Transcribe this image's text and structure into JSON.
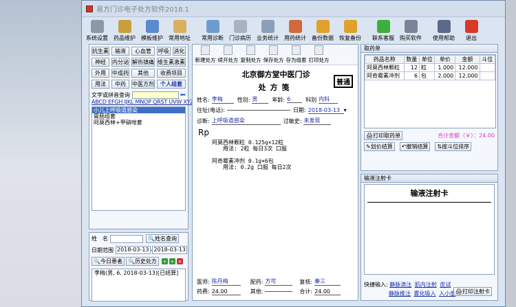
{
  "window_title": "易方门诊电子处方软件2018.1",
  "toolbar": [
    {
      "label": "系统设置",
      "icon": "gear-icon",
      "color": "#8a98a8"
    },
    {
      "label": "药品维护",
      "icon": "medicine-icon",
      "color": "#c8a03a"
    },
    {
      "label": "模板维护",
      "icon": "template-icon",
      "color": "#5a8ad0"
    },
    {
      "label": "常用地址",
      "icon": "map-pin-icon",
      "color": "#d8b060"
    },
    {
      "label": "常用诊断",
      "icon": "diagnosis-icon",
      "color": "#6f9ccf"
    },
    {
      "label": "门诊病历",
      "icon": "record-icon",
      "color": "#a7b3c2"
    },
    {
      "label": "业务统计",
      "icon": "stats-icon",
      "color": "#8aa0b8"
    },
    {
      "label": "用药统计",
      "icon": "pie-chart-icon",
      "color": "#d06a3a"
    },
    {
      "label": "备份数据",
      "icon": "backup-icon",
      "color": "#e0a02a"
    },
    {
      "label": "恢复备份",
      "icon": "restore-icon",
      "color": "#e0a02a"
    },
    {
      "label": "联系客服",
      "icon": "wechat-icon",
      "color": "#3cb03c"
    },
    {
      "label": "购买软件",
      "icon": "buy-icon",
      "color": "#7a8496"
    },
    {
      "label": "使用帮助",
      "icon": "help-icon",
      "color": "#5a6a88"
    },
    {
      "label": "退出",
      "icon": "exit-icon",
      "color": "#d83a2a"
    }
  ],
  "categories": [
    [
      {
        "label": "抗生素"
      },
      {
        "label": "输液"
      },
      {
        "label": "心血管"
      },
      {
        "label": "呼吸"
      },
      {
        "label": "消化"
      }
    ],
    [
      {
        "label": "神经"
      },
      {
        "label": "内分泌"
      },
      {
        "label": "解热镇痛"
      },
      {
        "label": "维生素激素"
      }
    ],
    [
      {
        "label": "外用"
      },
      {
        "label": "中成药"
      },
      {
        "label": "其他"
      },
      {
        "label": "收费项目"
      }
    ],
    [
      {
        "label": "用法"
      },
      {
        "label": "中药"
      },
      {
        "label": "中医方剂"
      },
      {
        "label": "个人组套"
      }
    ]
  ],
  "search_label": "文字或拼音查询",
  "alphabet": "ABCD EFGH IJKL MNOP QRST UVW XYZ",
  "template_list": [
    "小儿上呼吸道感染",
    "胃肠组套",
    "阿莫西林+甲硝唑套"
  ],
  "patient_search": {
    "name_label": "姓　名",
    "name_button": "姓名查询",
    "date_label": "日期范围",
    "date_from": "2018-03-13",
    "date_sep": "-",
    "date_to": "2018-03-13",
    "today_button": "今日患者",
    "history_button": "历史处方",
    "result": "李梅(男, 6, 2018-03-13)[已结算]"
  },
  "center_toolbar": [
    "新建处方",
    "续开处方",
    "复制处方",
    "保存处方",
    "存为组套",
    "打印处方"
  ],
  "prescription": {
    "clinic": "北京御方堂中医门诊",
    "title": "处方笺",
    "type_badge": "普通",
    "name_label": "姓名:",
    "name": "李梅",
    "sex_label": "性别:",
    "sex": "男",
    "age_label": "年龄:",
    "age": "6",
    "dept_label": "科别",
    "dept": "内科",
    "address_label": "住址(电话):",
    "address": "",
    "date_label": "日期:",
    "date": "2018-03-13",
    "diagnosis_label": "诊断:",
    "diagnosis": "上呼吸道感染",
    "allergy_label": "过敏史:",
    "allergy": "未发现",
    "rp": "Rp",
    "drugs": [
      {
        "name": "阿莫西林颗粒 0.125g×12粒",
        "usage": "用法: 2粒 每日3次 口服"
      },
      {
        "name": "阿奇霉素冲剂 0.1g×6包",
        "usage": "用法: 0.2g 口服 每日2次"
      }
    ],
    "doctor_label": "医师:",
    "doctor": "陈丹梅",
    "dispense_label": "配药:",
    "dispense": "方可",
    "check_label": "复核:",
    "check": "秦三",
    "drugfee_label": "药费:",
    "drugfee": "24.00",
    "other_label": "其他:",
    "other": "",
    "sum_label": "合计:",
    "sum": "24.00"
  },
  "drug_panel": {
    "title": "取药单",
    "headers": [
      "药品名称",
      "数量",
      "单位",
      "单价",
      "金额",
      "斗位"
    ],
    "rows": [
      [
        "阿莫西林颗粒",
        "12",
        "粒",
        "1.000",
        "12.000",
        ""
      ],
      [
        "阿奇霉素冲剂",
        "6",
        "包",
        "2.000",
        "12.000",
        ""
      ]
    ],
    "print_button": "打印取药单",
    "total_label": "合计金额（￥）：",
    "total_value": "24.00",
    "settle_button": "划价结算",
    "cancel_button": "撤销结算",
    "sort_button": "按斗位排序"
  },
  "injection_panel": {
    "title": "输液注射卡",
    "card_title": "输液注射卡",
    "quick_label": "快捷输入:",
    "quick_links": [
      "静脉滴注",
      "肌内注射",
      "皮试",
      "静脉推注",
      "雾化吸入",
      "入小壶"
    ],
    "print_button": "打印注射卡"
  }
}
